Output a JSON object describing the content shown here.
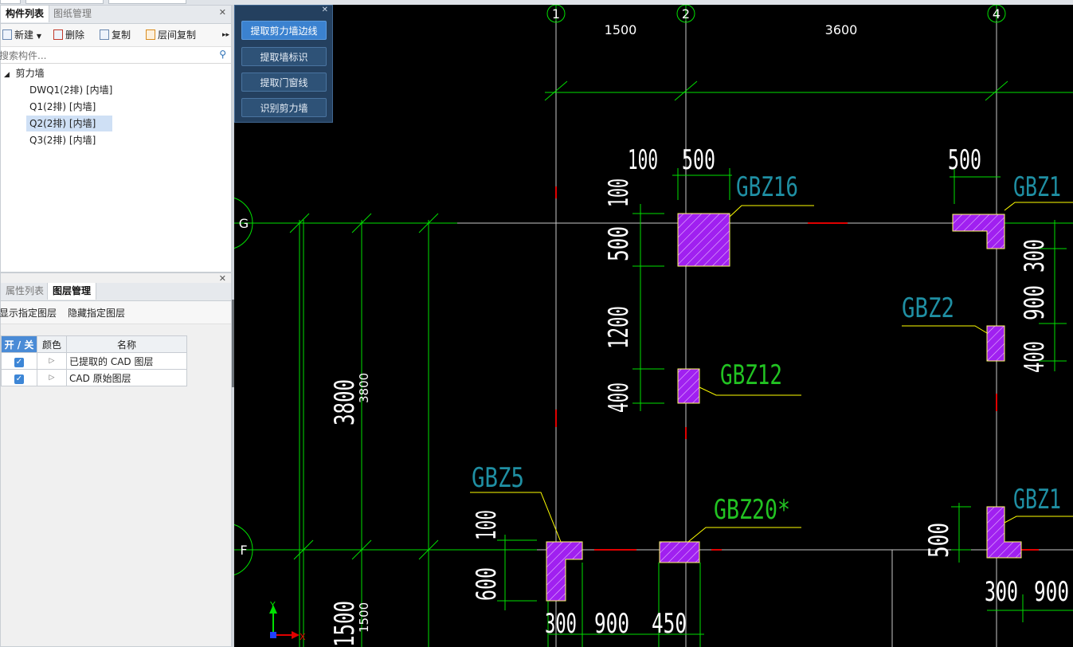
{
  "component_panel": {
    "tabs": [
      "构件列表",
      "图纸管理"
    ],
    "toolbar": {
      "new": "新建",
      "delete": "删除",
      "copy": "复制",
      "floor_copy": "层间复制"
    },
    "search_placeholder": "搜索构件...",
    "tree": {
      "root": "剪力墙",
      "items": [
        "DWQ1(2排) [内墙]",
        "Q1(2排) [内墙]",
        "Q2(2排) [内墙]",
        "Q3(2排) [内墙]"
      ],
      "selected_index": 2
    }
  },
  "layer_panel": {
    "tabs": [
      "属性列表",
      "图层管理"
    ],
    "toolbar": {
      "show": "显示指定图层",
      "hide": "隐藏指定图层"
    },
    "columns": {
      "onoff": "开 / 关",
      "color": "颜色",
      "name": "名称"
    },
    "rows": [
      {
        "checked": true,
        "name": "已提取的 CAD 图层"
      },
      {
        "checked": true,
        "name": "CAD 原始图层"
      }
    ]
  },
  "float_panel": {
    "buttons": [
      "提取剪力墙边线",
      "提取墙标识",
      "提取门窗线",
      "识别剪力墙"
    ]
  },
  "drawing": {
    "axis_bubbles": {
      "top": [
        "1",
        "2",
        "4"
      ],
      "left": [
        "G",
        "F"
      ]
    },
    "top_dims": [
      "1500",
      "3600"
    ],
    "vertical_labels": [
      "3800",
      "3800",
      "1500",
      "1500"
    ],
    "dim_text": [
      "100",
      "500",
      "100",
      "500",
      "1200",
      "400",
      "500",
      "300",
      "900",
      "400",
      "100",
      "600",
      "300",
      "900",
      "450",
      "500",
      "300",
      "900"
    ],
    "wall_labels": [
      "GBZ16",
      "GBZ1",
      "GBZ2",
      "GBZ12",
      "GBZ5",
      "GBZ20*",
      "GBZ1"
    ],
    "ucs": {
      "x": "X",
      "y": "Y"
    }
  },
  "colors": {
    "canvas_bg": "#000000",
    "axis_green": "#00e000",
    "grid_grey": "#c8c8c8",
    "column_fill": "#a020f0",
    "label_teal": "#1f8fa3",
    "leader_yellow": "#ffff00",
    "accent_blue": "#3b82d0"
  }
}
